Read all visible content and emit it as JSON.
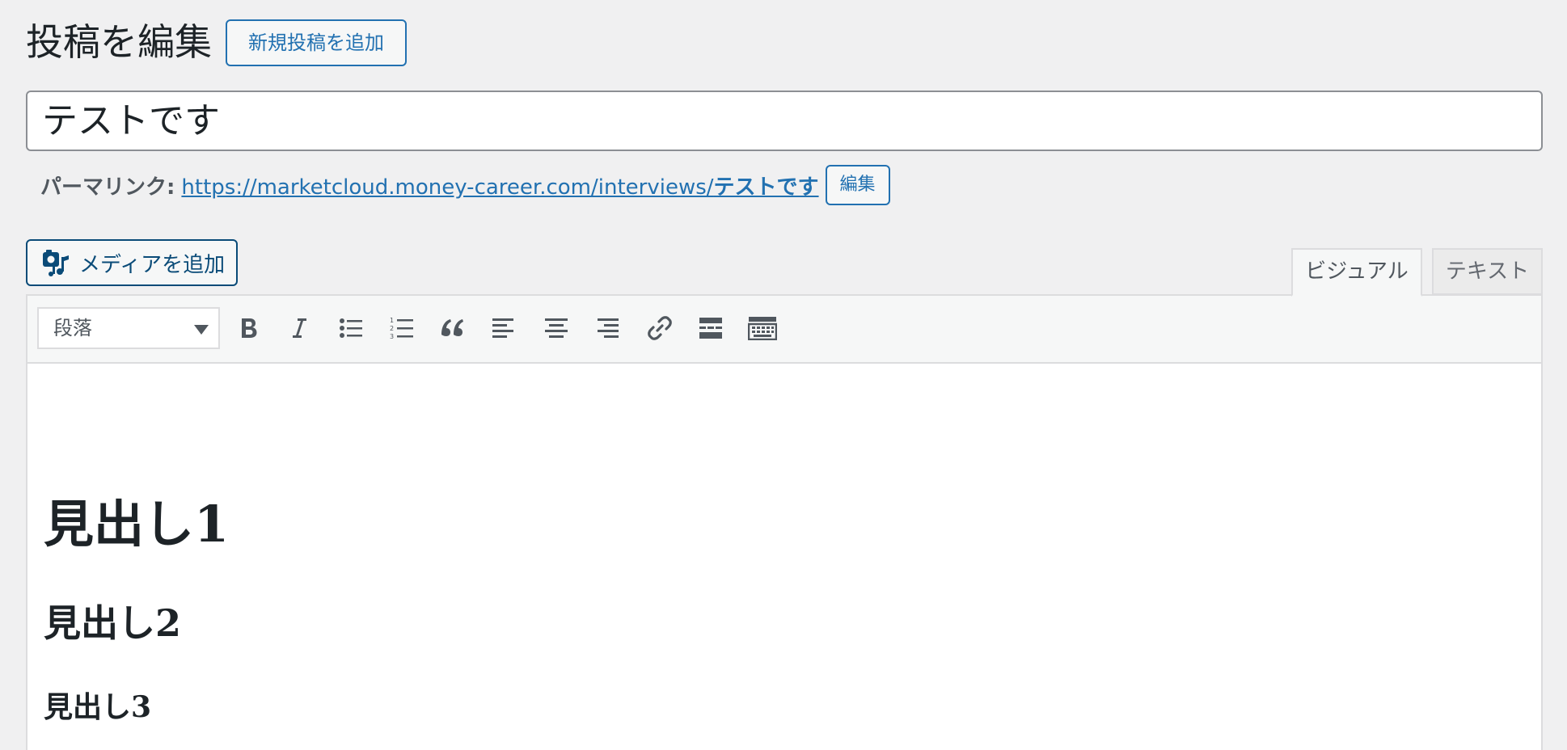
{
  "header": {
    "title": "投稿を編集",
    "add_new_label": "新規投稿を追加"
  },
  "post": {
    "title_value": "テストです"
  },
  "permalink": {
    "label": "パーマリンク:",
    "base_url": "https://marketcloud.money-career.com/interviews/",
    "slug": "テストです",
    "edit_label": "編集"
  },
  "media": {
    "add_label": "メディアを追加",
    "icon": "add-media-icon"
  },
  "tabs": {
    "visual_label": "ビジュアル",
    "text_label": "テキスト",
    "active": "visual"
  },
  "toolbar": {
    "format_value": "段落",
    "buttons": [
      "bold-icon",
      "italic-icon",
      "bulleted-list-icon",
      "numbered-list-icon",
      "blockquote-icon",
      "align-left-icon",
      "align-center-icon",
      "align-right-icon",
      "link-icon",
      "read-more-icon",
      "toolbar-toggle-icon"
    ]
  },
  "content": {
    "heading1": "見出し1",
    "heading2": "見出し2",
    "heading3": "見出し3"
  },
  "colors": {
    "accent": "#2271b1",
    "page_bg": "#f0f0f1",
    "text": "#1d2327"
  }
}
